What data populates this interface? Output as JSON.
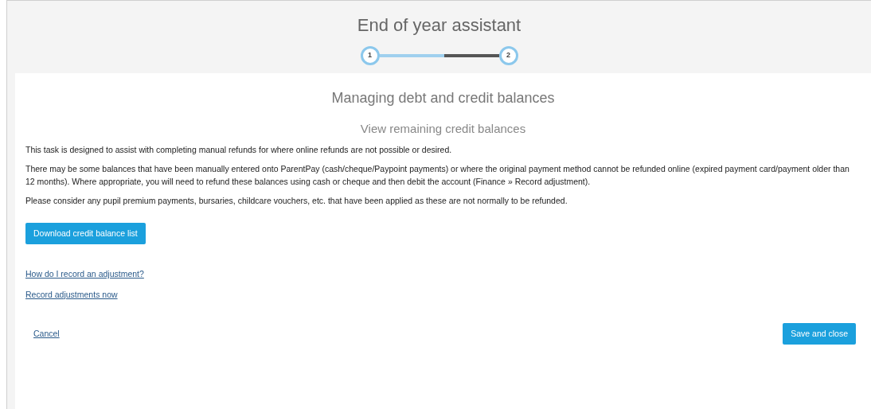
{
  "header": {
    "title": "End of year assistant",
    "steps": [
      {
        "label": "1",
        "done": true
      },
      {
        "label": "2",
        "done": true
      }
    ],
    "progress": {
      "level": 0.54
    }
  },
  "panel": {
    "title": "Managing debt and credit balances",
    "subtitle": "View remaining credit balances",
    "paragraphs": [
      "This task is designed to assist with completing manual refunds for where online refunds are not possible or desired.",
      "There may be some balances that have been manually entered onto ParentPay (cash/cheque/Paypoint payments) or where the original payment method cannot be refunded online (expired payment card/payment older than 12 months). Where appropriate, you will need to refund these balances using cash or cheque and then debit the account (Finance » Record adjustment).",
      "Please consider any pupil premium payments, bursaries, childcare vouchers, etc. that have been applied as these are not normally to be refunded."
    ],
    "download_button": "Download credit balance list",
    "links": [
      "How do I record an adjustment?",
      "Record adjustments now"
    ]
  },
  "footer": {
    "cancel": "Cancel",
    "save": "Save and close"
  }
}
